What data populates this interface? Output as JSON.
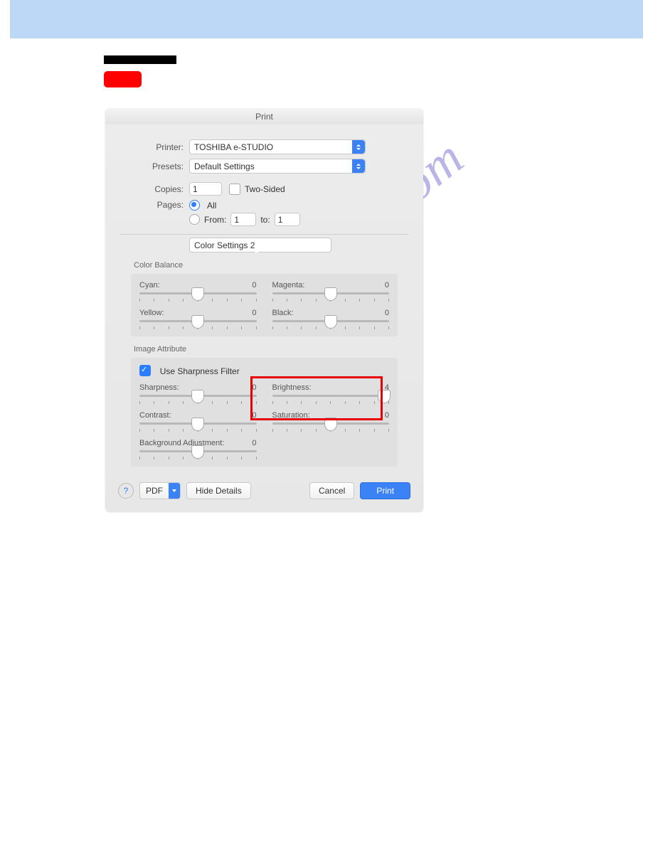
{
  "watermark": "manualshive.com",
  "dialog": {
    "title": "Print",
    "printer_label": "Printer:",
    "printer_value": "TOSHIBA e-STUDIO",
    "presets_label": "Presets:",
    "presets_value": "Default Settings",
    "copies_label": "Copies:",
    "copies_value": "1",
    "two_sided_label": "Two-Sided",
    "pages_label": "Pages:",
    "pages_all": "All",
    "pages_from_label": "From:",
    "pages_from_value": "1",
    "pages_to_label": "to:",
    "pages_to_value": "1",
    "section_value": "Color Settings 2"
  },
  "color_balance": {
    "title": "Color Balance",
    "cyan_label": "Cyan:",
    "cyan_value": "0",
    "magenta_label": "Magenta:",
    "magenta_value": "0",
    "yellow_label": "Yellow:",
    "yellow_value": "0",
    "black_label": "Black:",
    "black_value": "0"
  },
  "image_attr": {
    "title": "Image Attribute",
    "use_sharpness_label": "Use Sharpness Filter",
    "sharpness_label": "Sharpness:",
    "sharpness_value": "0",
    "brightness_label": "Brightness:",
    "brightness_value": "4",
    "contrast_label": "Contrast:",
    "contrast_value": "0",
    "saturation_label": "Saturation:",
    "saturation_value": "0",
    "bg_adjust_label": "Background Adjustment:",
    "bg_adjust_value": "0"
  },
  "footer": {
    "pdf_label": "PDF",
    "hide_details": "Hide Details",
    "cancel": "Cancel",
    "print": "Print",
    "help": "?"
  }
}
